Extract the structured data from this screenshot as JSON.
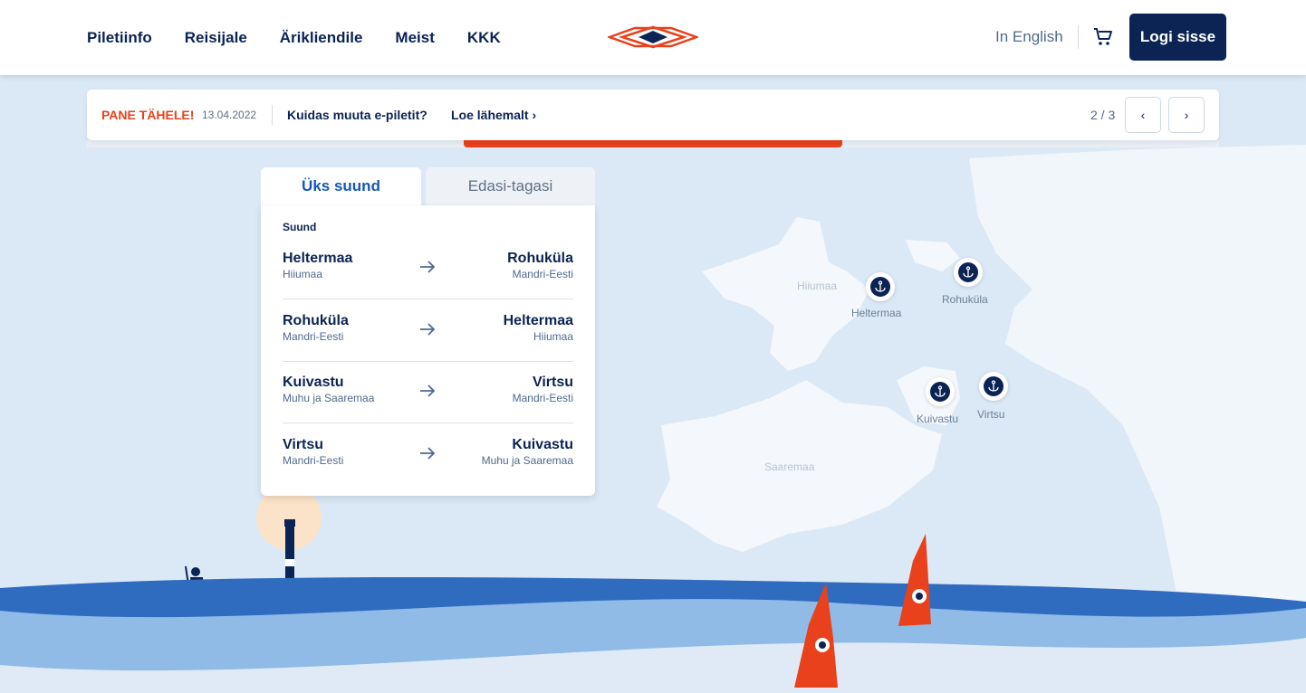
{
  "nav": {
    "items": [
      "Piletiinfo",
      "Reisijale",
      "Ärikliendile",
      "Meist",
      "KKK"
    ],
    "language": "In English",
    "login": "Logi sisse"
  },
  "notice": {
    "tag": "PANE TÄHELE!",
    "date": "13.04.2022",
    "message": "Kuidas muuta e-piletit?",
    "more": "Loe lähemalt",
    "more_icon": "chevron-right-icon",
    "pager": "2 / 3",
    "prev_icon": "‹",
    "next_icon": "›"
  },
  "tabs": {
    "one_way": "Üks suund",
    "round_trip": "Edasi-tagasi"
  },
  "panel": {
    "label": "Suund",
    "routes": [
      {
        "from_city": "Heltermaa",
        "from_region": "Hiiumaa",
        "to_city": "Rohuküla",
        "to_region": "Mandri-Eesti"
      },
      {
        "from_city": "Rohuküla",
        "from_region": "Mandri-Eesti",
        "to_city": "Heltermaa",
        "to_region": "Hiiumaa"
      },
      {
        "from_city": "Kuivastu",
        "from_region": "Muhu ja Saaremaa",
        "to_city": "Virtsu",
        "to_region": "Mandri-Eesti"
      },
      {
        "from_city": "Virtsu",
        "from_region": "Mandri-Eesti",
        "to_city": "Kuivastu",
        "to_region": "Muhu ja Saaremaa"
      }
    ]
  },
  "map": {
    "islands": {
      "hiiumaa": "Hiiumaa",
      "saaremaa": "Saaremaa"
    },
    "ports": {
      "heltermaa": "Heltermaa",
      "rohukula": "Rohuküla",
      "kuivastu": "Kuivastu",
      "virtsu": "Virtsu"
    }
  },
  "colors": {
    "brand_navy": "#0b2454",
    "accent_orange": "#e8411c",
    "sea_dark": "#2f6bbf",
    "sea_mid": "#8fbbe6",
    "land": "#f4f8fc"
  }
}
